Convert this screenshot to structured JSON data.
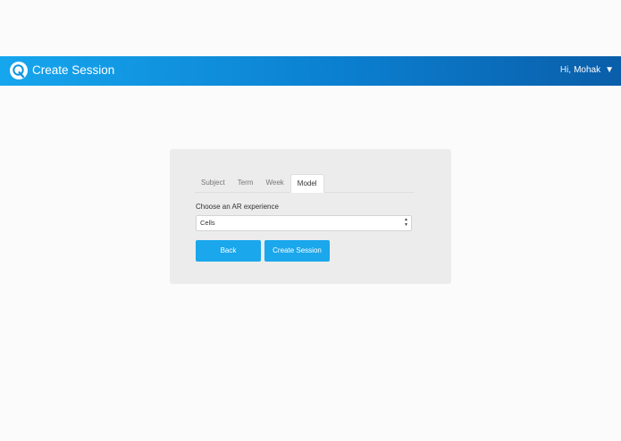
{
  "header": {
    "title": "Create Session",
    "greeting_prefix": "Hi,",
    "user_name": "Mohak",
    "menu_caret": "▼",
    "logo_icon": "q-logo-icon",
    "gradient_colors": [
      "#16a6ee",
      "#0b7fd0",
      "#0a5ea9"
    ]
  },
  "tabs": [
    {
      "label": "Subject"
    },
    {
      "label": "Term"
    },
    {
      "label": "Week"
    },
    {
      "label": "Model",
      "active": true
    }
  ],
  "form": {
    "label": "Choose an AR experience",
    "select_value": "Cells",
    "select_icon": "up-down-chevron-icon"
  },
  "buttons": {
    "back": "Back",
    "create": "Create Session",
    "color": "#1aa7ec"
  }
}
